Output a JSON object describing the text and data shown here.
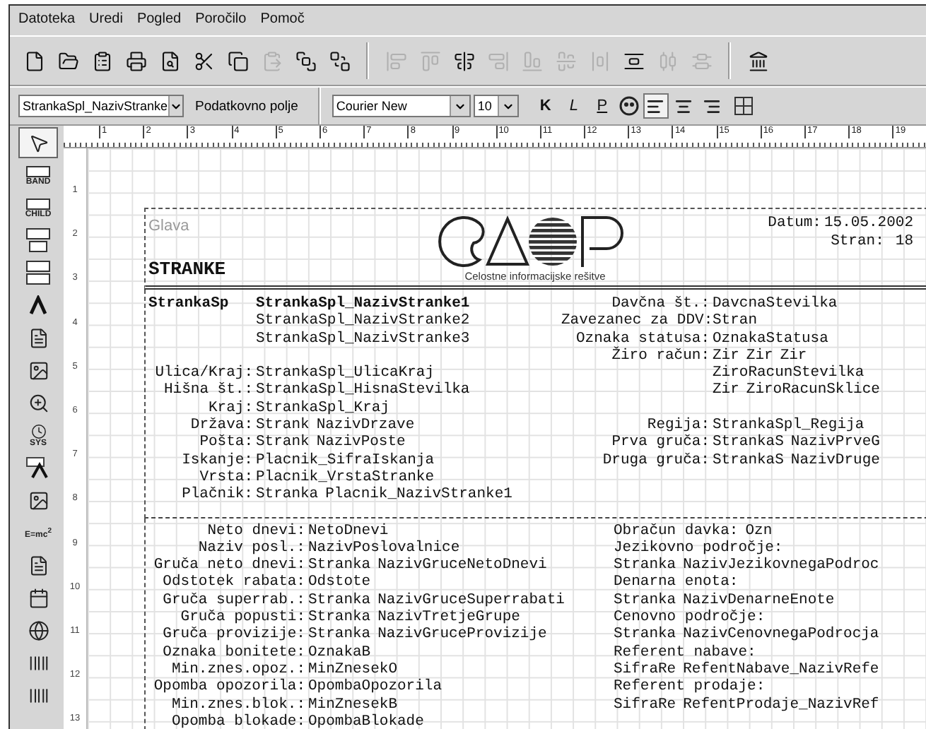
{
  "menu": [
    {
      "label": "Datoteka"
    },
    {
      "label": "Uredi"
    },
    {
      "label": "Pogled"
    },
    {
      "label": "Poročilo"
    },
    {
      "label": "Pomoč"
    }
  ],
  "toolbar": [
    {
      "kind": "new",
      "disabled": false
    },
    {
      "kind": "open",
      "disabled": false
    },
    {
      "kind": "clipboard",
      "disabled": false
    },
    {
      "kind": "print",
      "disabled": false
    },
    {
      "kind": "preview",
      "disabled": false
    },
    {
      "kind": "cut",
      "disabled": false
    },
    {
      "kind": "copy",
      "disabled": false
    },
    {
      "kind": "paste",
      "disabled": true
    },
    {
      "kind": "front",
      "disabled": false
    },
    {
      "kind": "back",
      "disabled": false
    },
    {
      "kind": "separator"
    },
    {
      "kind": "align-left",
      "disabled": true
    },
    {
      "kind": "align-top",
      "disabled": true
    },
    {
      "kind": "center-h",
      "disabled": false
    },
    {
      "kind": "align-right",
      "disabled": true
    },
    {
      "kind": "align-bottom",
      "disabled": true
    },
    {
      "kind": "center-v",
      "disabled": true
    },
    {
      "kind": "space-h",
      "disabled": true
    },
    {
      "kind": "space-v",
      "disabled": false
    },
    {
      "kind": "dist-h",
      "disabled": true
    },
    {
      "kind": "dist-v",
      "disabled": true
    },
    {
      "kind": "separator"
    },
    {
      "kind": "pillar",
      "disabled": false
    }
  ],
  "format_bar": {
    "field": "StrankaSpl_NazivStranke",
    "field_caption": "Podatkovno polje",
    "font": "Courier New",
    "size": "10",
    "styles": [
      {
        "label": "K",
        "kind": "bold",
        "selected": false
      },
      {
        "label": "L",
        "kind": "italic",
        "selected": false
      },
      {
        "label": "P",
        "kind": "underline",
        "selected": false
      }
    ],
    "alignment": [
      {
        "kind": "left",
        "selected": true
      },
      {
        "kind": "center",
        "selected": false
      },
      {
        "kind": "right",
        "selected": false
      }
    ]
  },
  "ruler": [
    "1",
    "2",
    "3",
    "4",
    "5",
    "6",
    "7",
    "8",
    "9",
    "10",
    "11",
    "12",
    "13",
    "14",
    "15",
    "16",
    "17",
    "18",
    "19"
  ],
  "line_numbers": [
    "1",
    "2",
    "3",
    "4",
    "5",
    "6",
    "7",
    "8",
    "9",
    "10",
    "11",
    "12",
    "13"
  ],
  "palette": [
    {
      "kind": "pointer",
      "selected": true
    },
    {
      "kind": "band",
      "label": "BAND",
      "selected": false
    },
    {
      "kind": "band",
      "label": "CHILD",
      "selected": false
    },
    {
      "kind": "group",
      "selected": false
    },
    {
      "kind": "subgroup",
      "selected": false
    },
    {
      "kind": "caret",
      "selected": false
    },
    {
      "kind": "memo",
      "selected": false
    },
    {
      "kind": "image",
      "selected": false
    },
    {
      "kind": "zoom",
      "selected": false
    },
    {
      "kind": "clock",
      "label": "SYS",
      "selected": false
    },
    {
      "kind": "caret-frame",
      "selected": false
    },
    {
      "kind": "image",
      "selected": false
    },
    {
      "kind": "formula",
      "label": "E=mc$^{2}$",
      "selected": false
    },
    {
      "kind": "memo",
      "selected": false
    },
    {
      "kind": "calendar",
      "selected": false
    },
    {
      "kind": "globe",
      "selected": false
    },
    {
      "kind": "barcode",
      "selected": false
    },
    {
      "kind": "barcode",
      "selected": false
    }
  ],
  "report": {
    "header": {
      "band_label": "Glava",
      "title": "STRANKE",
      "tagline": "Celostne informacijske rešitve",
      "date_label": "Datum:",
      "date": "15.05.2002",
      "page_label": "Stran:",
      "page": "18"
    },
    "detail": [
      {
        "kind": "heading",
        "label": "StrankaSp",
        "fields": [
          "StrankaSpl_NazivStranke1"
        ],
        "right_label": "Davčna št.:",
        "right_fields": [
          "DavcnaStevilka"
        ]
      },
      {
        "kind": "row",
        "fields": [
          "StrankaSpl_NazivStranke2"
        ],
        "right_label": "Zavezanec za DDV:",
        "right_fields": [
          "Stran"
        ]
      },
      {
        "kind": "row",
        "fields": [
          "StrankaSpl_NazivStranke3"
        ],
        "right_label": "Oznaka statusa:",
        "right_fields": [
          "OznakaStatusa"
        ]
      },
      {
        "kind": "row",
        "right_label": "Žiro račun:",
        "right_fields": [
          "Zir",
          "Zir",
          "Zir"
        ]
      },
      {
        "kind": "row",
        "label": "Ulica/Kraj:",
        "fields": [
          "StrankaSpl_UlicaKraj"
        ],
        "right_fields": [
          "ZiroRacunStevilka"
        ]
      },
      {
        "kind": "row",
        "label": "Hišna št.:",
        "fields": [
          "StrankaSpl_HisnaStevilka"
        ],
        "right_fields": [
          "Zir",
          "ZiroRacunSklice"
        ]
      },
      {
        "kind": "row",
        "label": "Kraj:",
        "fields": [
          "StrankaSpl_Kraj"
        ]
      },
      {
        "kind": "row",
        "label": "Država:",
        "fields": [
          "Strank",
          "NazivDrzave"
        ],
        "right_label": "Regija:",
        "right_fields": [
          "StrankaSpl_Regija"
        ]
      },
      {
        "kind": "row",
        "label": "Pošta:",
        "fields": [
          "Strank",
          "NazivPoste"
        ],
        "right_label": "Prva gruča:",
        "right_fields": [
          "StrankaS",
          "NazivPrveG"
        ]
      },
      {
        "kind": "row",
        "label": "Iskanje:",
        "fields": [
          "Placnik_SifraIskanja"
        ],
        "right_label": "Druga gruča:",
        "right_fields": [
          "StrankaS",
          "NazivDruge"
        ]
      },
      {
        "kind": "row",
        "label": "Vrsta:",
        "fields": [
          "Placnik_VrstaStranke"
        ]
      },
      {
        "kind": "row",
        "label": "Plačnik:",
        "fields": [
          "Stranka",
          "Placnik_NazivStranke1"
        ]
      }
    ],
    "footer": [
      {
        "label": "Neto dnevi:",
        "fields": [
          "NetoDnevi"
        ],
        "right_label": "Obračun davka:",
        "right_fields": [
          "Ozn"
        ]
      },
      {
        "label": "Naziv posl.:",
        "fields": [
          "NazivPoslovalnice"
        ],
        "right_label": "Jezikovno področje:"
      },
      {
        "label": "Gruča neto dnevi:",
        "fields": [
          "Stranka",
          "NazivGruceNetoDnevi"
        ],
        "right_fields": [
          "Stranka",
          "NazivJezikovnegaPodroc"
        ]
      },
      {
        "label": "Odstotek rabata:",
        "fields": [
          "Odstote"
        ],
        "right_label": "Denarna enota:"
      },
      {
        "label": "Gruča superrab.:",
        "fields": [
          "Stranka",
          "NazivGruceSuperrabati"
        ],
        "right_fields": [
          "Stranka",
          "NazivDenarneEnote"
        ]
      },
      {
        "label": "Gruča popusti:",
        "fields": [
          "Stranka",
          "NazivTretjeGrupe"
        ],
        "right_label": "Cenovno področje:"
      },
      {
        "label": "Gruča provizije:",
        "fields": [
          "Stranka",
          "NazivGruceProvizije"
        ],
        "right_fields": [
          "Stranka",
          "NazivCenovnegaPodrocja"
        ]
      },
      {
        "label": "Oznaka bonitete:",
        "fields": [
          "OznakaB"
        ],
        "right_label": "Referent nabave:"
      },
      {
        "label": "Min.znes.opoz.:",
        "fields": [
          "MinZnesekO"
        ],
        "right_fields": [
          "SifraRe",
          "RefentNabave_NazivRefe"
        ]
      },
      {
        "label": "Opomba opozorila:",
        "fields": [
          "OpombaOpozorila"
        ],
        "right_label": "Referent prodaje:"
      },
      {
        "label": "Min.znes.blok.:",
        "fields": [
          "MinZnesekB"
        ],
        "right_fields": [
          "SifraRe",
          "RefentProdaje_NazivRef"
        ]
      },
      {
        "label": "Opomba blokade:",
        "fields": [
          "OpombaBlokade"
        ]
      }
    ]
  }
}
